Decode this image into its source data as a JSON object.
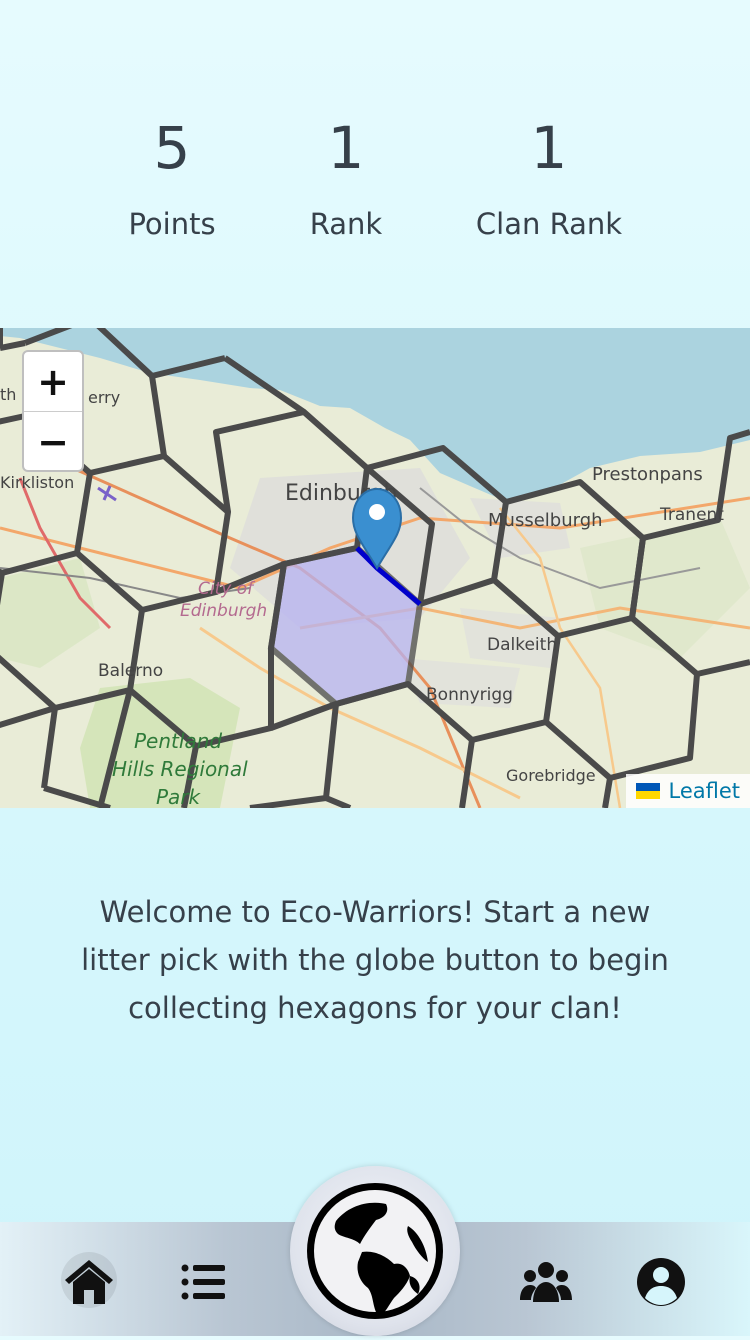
{
  "stats": {
    "points": {
      "value": "5",
      "label": "Points"
    },
    "rank": {
      "value": "1",
      "label": "Rank"
    },
    "clan_rank": {
      "value": "1",
      "label": "Clan Rank"
    }
  },
  "map": {
    "zoom_in": "+",
    "zoom_out": "−",
    "attribution": "Leaflet",
    "place_labels": {
      "edinburgh": "Edinburgh",
      "musselburgh": "Musselburgh",
      "prestonpans": "Prestonpans",
      "tranent": "Tranent",
      "dalkeith": "Dalkeith",
      "bonnyrigg": "Bonnyrigg",
      "gorebridge": "Gorebridge",
      "balerno": "Balerno",
      "kirkliston": "Kirkliston",
      "queensferry": "erry",
      "city_of": "City of",
      "city_edinburgh": "Edinburgh",
      "pentland_1": "Pentland",
      "pentland_2": "Hills Regional",
      "pentland_3": "Park",
      "edge": "th"
    },
    "colors": {
      "sea": "#abd3df",
      "land": "#e9ecd7",
      "hex_stroke": "#4a4a4a",
      "selected_hex": "#b7b3f2",
      "route": "#0000cc",
      "marker": "#3a8fd0"
    }
  },
  "welcome_text": "Welcome to Eco-Warriors! Start a new litter pick with the globe button to begin collecting hexagons for your clan!",
  "nav": {
    "items": [
      "home-icon",
      "list-icon",
      "globe-icon",
      "users-icon",
      "profile-icon"
    ],
    "active": "home"
  }
}
